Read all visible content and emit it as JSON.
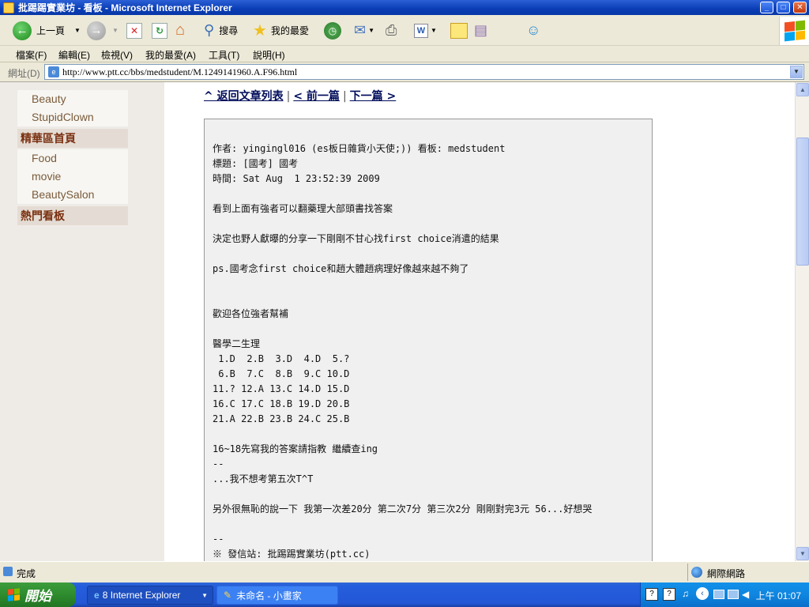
{
  "window": {
    "title": "批踢踢實業坊 - 看板 - Microsoft Internet Explorer"
  },
  "toolbar": {
    "back_label": "上一頁",
    "search_label": "搜尋",
    "favorites_label": "我的最愛"
  },
  "menu": [
    "檔案(F)",
    "編輯(E)",
    "檢視(V)",
    "我的最愛(A)",
    "工具(T)",
    "說明(H)"
  ],
  "address": {
    "label": "網址(D)",
    "url": "http://www.ptt.cc/bbs/medstudent/M.1249141960.A.F96.html"
  },
  "sidebar": {
    "items_top": [
      "Beauty",
      "StupidClown"
    ],
    "head1": "精華區首頁",
    "items_mid": [
      "Food",
      "movie",
      "BeautySalon"
    ],
    "head2": "熱門看板"
  },
  "nav": {
    "back_to_list": "^ 返回文章列表",
    "prev": "< 前一篇",
    "next": "下一篇 >"
  },
  "post": {
    "lines": [
      "作者: yingingl016 (es板日雜貨小天使;)) 看板: medstudent",
      "標題: [國考] 國考",
      "時間: Sat Aug  1 23:52:39 2009",
      "",
      "看到上面有強者可以翻藥理大部頭書找答案",
      "",
      "決定也野人獻曝的分享一下剛剛不甘心找first choice消遣的結果",
      "",
      "ps.國考念first choice和趙大體趙病理好像越來越不夠了",
      "",
      "",
      "歡迎各位強者幫補",
      "",
      "醫學二生理",
      " 1.D  2.B  3.D  4.D  5.?",
      " 6.B  7.C  8.B  9.C 10.D",
      "11.? 12.A 13.C 14.D 15.D",
      "16.C 17.C 18.B 19.D 20.B",
      "21.A 22.B 23.B 24.C 25.B",
      "",
      "16~18先寫我的答案請指教 繼續查ing",
      "--",
      "...我不想考第五次T^T",
      "",
      "另外很無恥的說一下 我第一次差20分 第二次7分 第三次2分 剛剛對完3元 56...好想哭",
      "",
      "--",
      "※ 發信站: 批踢踢實業坊(ptt.cc)"
    ]
  },
  "status": {
    "text": "完成",
    "zone": "網際網路"
  },
  "taskbar": {
    "start": "開始",
    "task1": "8 Internet Explorer",
    "task2": "未命名 - 小畫家",
    "clock": "上午 01:07"
  }
}
